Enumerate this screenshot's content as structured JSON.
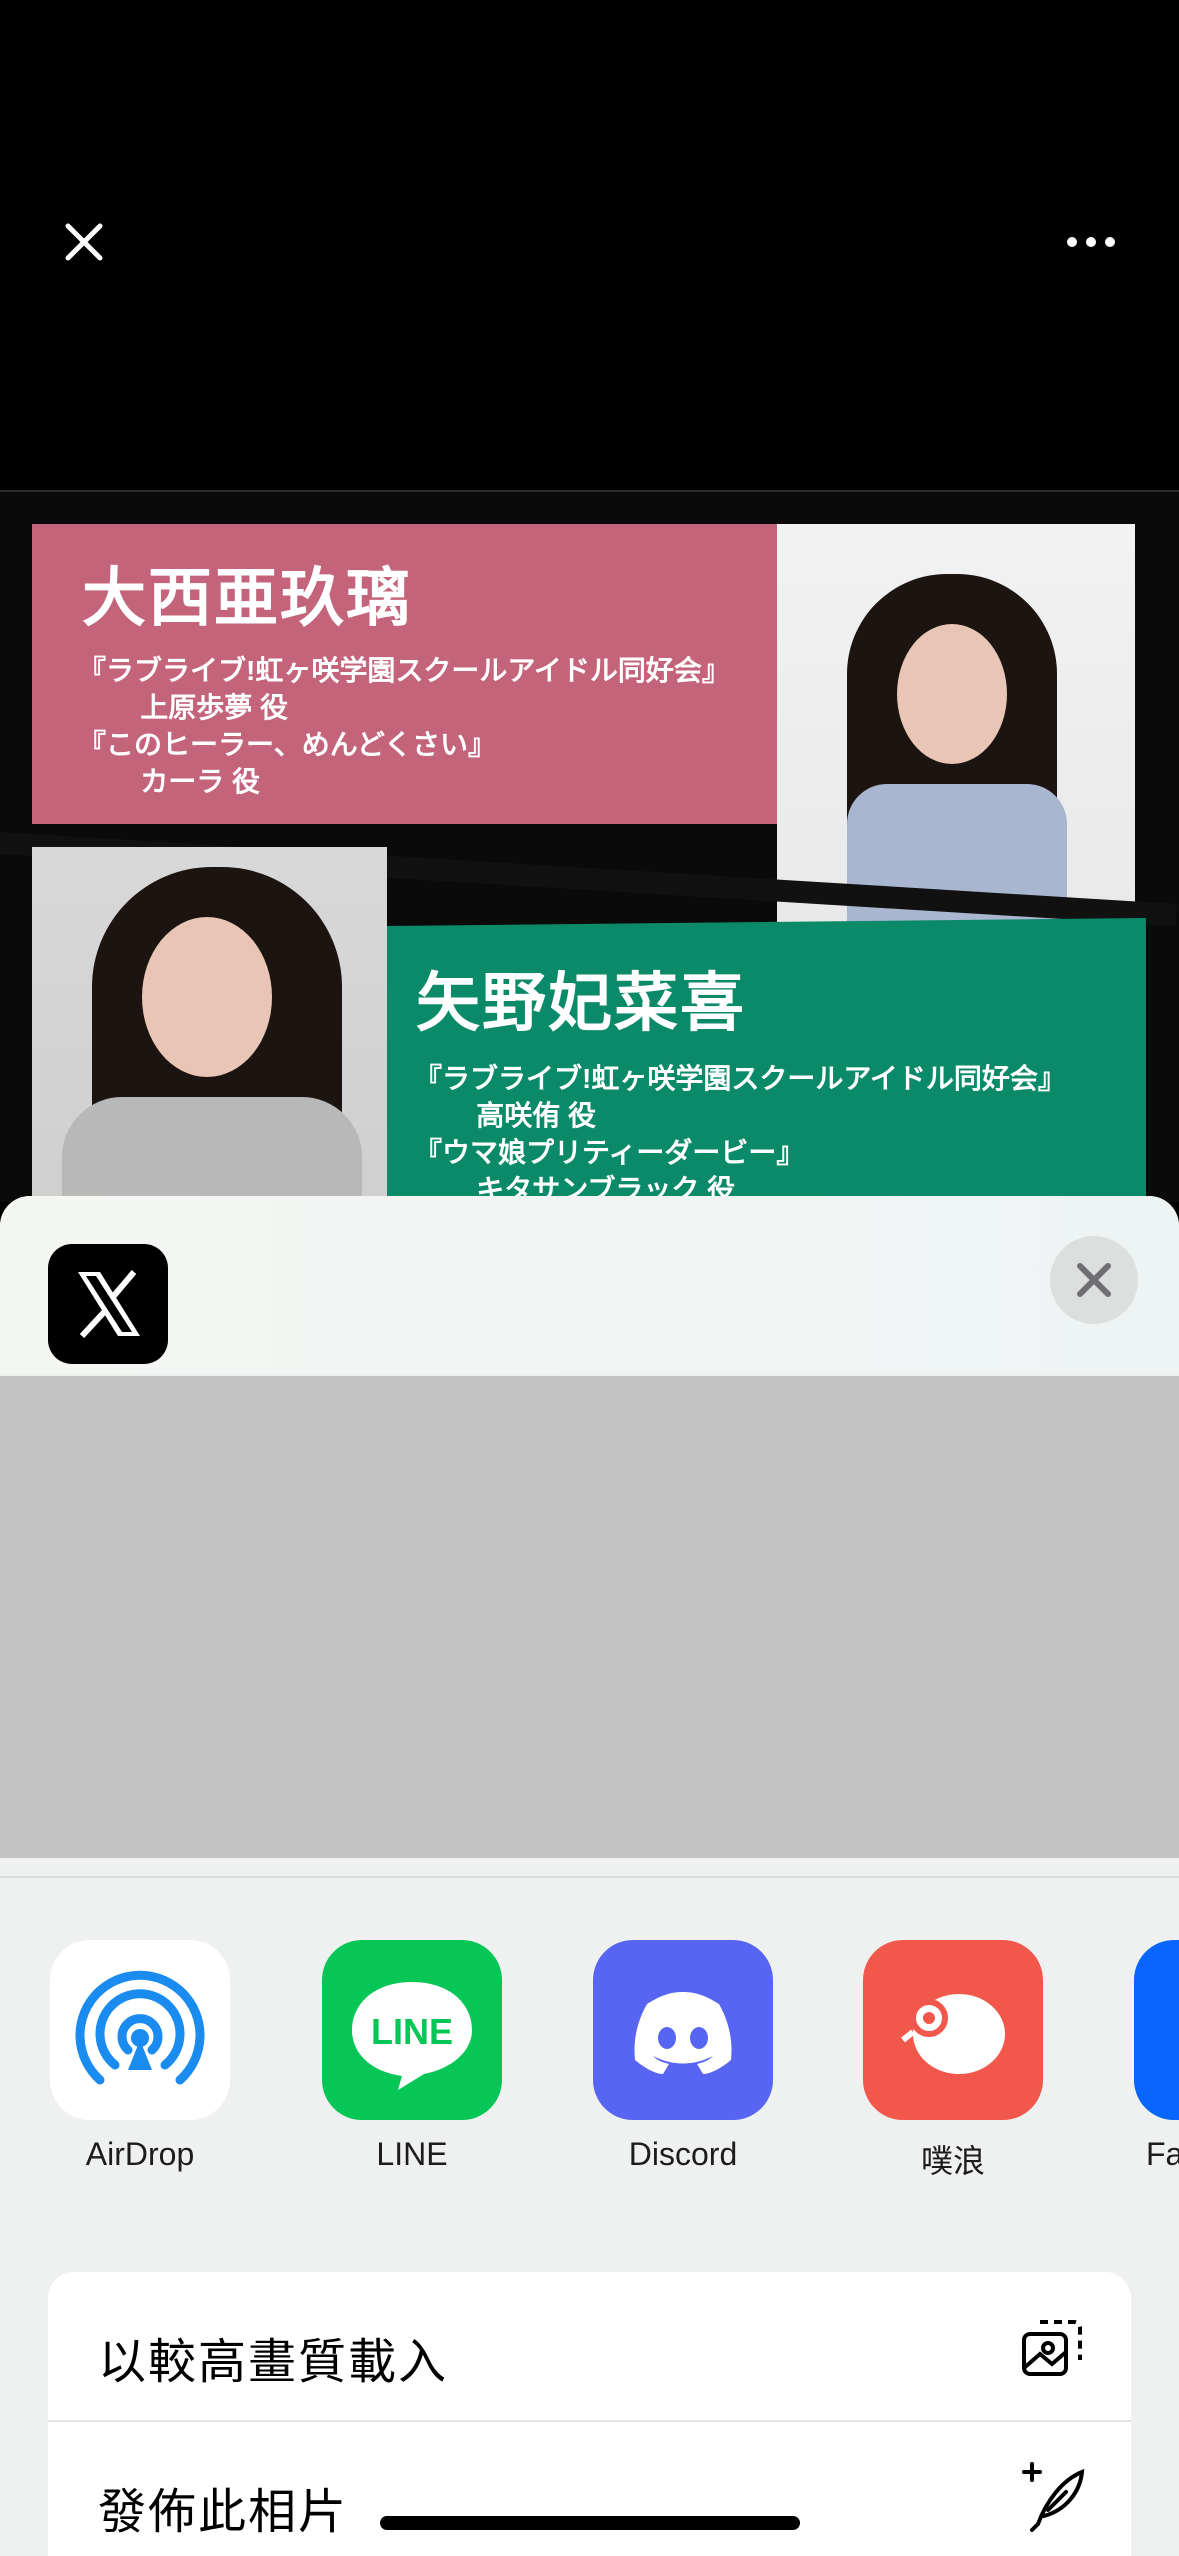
{
  "viewer": {
    "close_icon": "close-icon",
    "more_icon": "ellipsis-icon"
  },
  "photo": {
    "name1": "大西亜玖璃",
    "roles1": "『ラブライブ!虹ヶ咲学園スクールアイドル同好会』\n        上原歩夢 役\n『このヒーラー、めんどくさい』\n        カーラ 役",
    "name2": "矢野妃菜喜",
    "roles2": "『ラブライブ!虹ヶ咲学園スクールアイドル同好会』\n        高咲侑 役\n『ウマ娘プリティーダービー』\n        キタサンブラック 役"
  },
  "share_sheet": {
    "app_icon": "x-logo-icon",
    "apps": [
      {
        "label": "AirDrop",
        "icon": "airdrop-icon",
        "color": "#ffffff"
      },
      {
        "label": "LINE",
        "icon": "line-icon",
        "color": "#06c755"
      },
      {
        "label": "Discord",
        "icon": "discord-icon",
        "color": "#5865f2"
      },
      {
        "label": "噗浪",
        "icon": "plurk-icon",
        "color": "#f2574c"
      },
      {
        "label": "Fa",
        "icon": "facebook-icon",
        "color": "#0866ff"
      }
    ],
    "actions": [
      {
        "label": "以較高畫質載入",
        "icon": "hq-photo-icon"
      },
      {
        "label": "發佈此相片",
        "icon": "compose-feather-icon"
      }
    ]
  }
}
